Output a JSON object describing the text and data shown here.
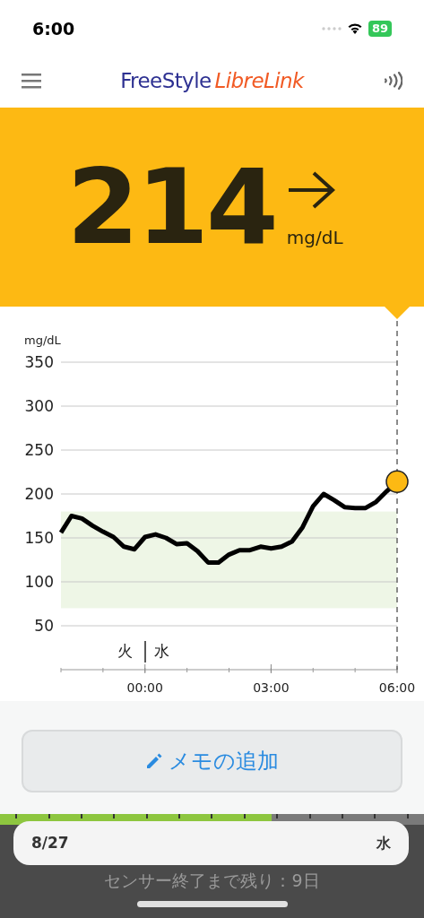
{
  "status_bar": {
    "time": "6:00",
    "battery": "89"
  },
  "header": {
    "logo_first": "FreeStyle",
    "logo_second": "LibreLink"
  },
  "reading": {
    "value": "214",
    "unit": "mg/dL"
  },
  "chart": {
    "unit": "mg/dL",
    "day_before": "火",
    "day_after": "水",
    "chart_data": {
      "type": "line",
      "grid": true,
      "bands": [
        {
          "axis": "y",
          "from": 70,
          "to": 180,
          "color": "#eef6e6"
        }
      ],
      "x": [
        -2,
        -1.75,
        -1.5,
        -1.25,
        -1,
        -0.75,
        -0.5,
        -0.25,
        0,
        0.25,
        0.5,
        0.75,
        1,
        1.25,
        1.5,
        1.75,
        2,
        2.25,
        2.5,
        2.75,
        3,
        3.25,
        3.5,
        3.75,
        4,
        4.25,
        4.5,
        4.75,
        5,
        5.25,
        5.5,
        5.75,
        6
      ],
      "series": [
        {
          "color": "#000000",
          "values": [
            156,
            175,
            172,
            164,
            157,
            151,
            140,
            137,
            151,
            154,
            150,
            143,
            144,
            135,
            122,
            122,
            131,
            136,
            136,
            140,
            138,
            140,
            146,
            162,
            186,
            200,
            193,
            185,
            184,
            184,
            191,
            203,
            214
          ]
        }
      ],
      "xlim": [
        -2,
        6
      ],
      "ylim": [
        0,
        350
      ],
      "xticks": [
        {
          "value": 0,
          "label": "00:00"
        },
        {
          "value": 3,
          "label": "03:00"
        },
        {
          "value": 6,
          "label": "06:00"
        }
      ],
      "yticks": [
        50,
        100,
        150,
        200,
        250,
        300,
        350
      ]
    }
  },
  "memo_button": {
    "label": "メモの追加"
  },
  "sensor": {
    "level": 0.64,
    "date": "8/27",
    "weekday": "水",
    "remaining": "センサー終了まで残り：9日"
  }
}
